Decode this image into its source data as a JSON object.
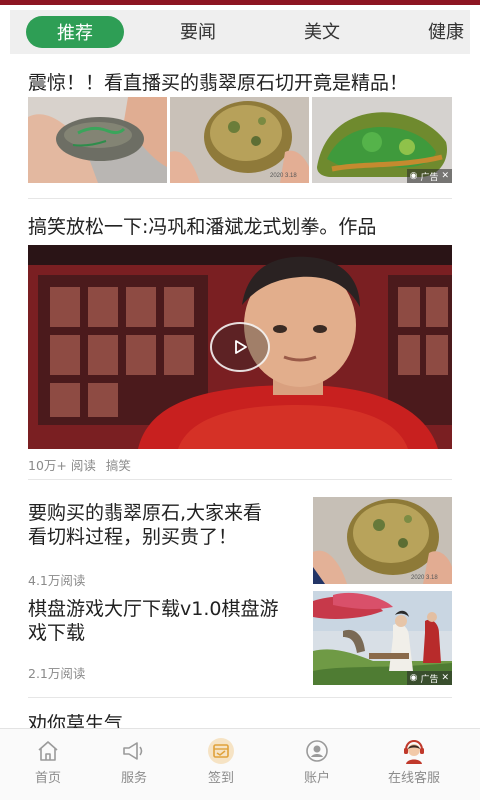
{
  "tabs": [
    {
      "label": "推荐"
    },
    {
      "label": "要闻"
    },
    {
      "label": "美文"
    },
    {
      "label": "健康"
    }
  ],
  "feed": [
    {
      "title": "震惊！！看直播买的翡翠原石切开竟是精品！",
      "ad_label": "广告"
    },
    {
      "title": "搞笑放松一下:冯巩和潘斌龙式划拳。作品",
      "views": "10万+ 阅读",
      "category": "搞笑"
    },
    {
      "title_line1": "要购买的翡翠原石,大家来看",
      "title_line2": "看切料过程，别买贵了！",
      "views": "4.1万阅读"
    },
    {
      "title_line1": "棋盘游戏大厅下载v1.0棋盘游",
      "title_line2": "戏下载",
      "views": "2.1万阅读",
      "ad_label": "广告"
    },
    {
      "title": "劝你莫生气"
    }
  ],
  "bottom_nav": [
    {
      "label": "首页",
      "icon": "home-icon"
    },
    {
      "label": "服务",
      "icon": "megaphone-icon"
    },
    {
      "label": "签到",
      "icon": "calendar-check-icon"
    },
    {
      "label": "账户",
      "icon": "user-icon"
    },
    {
      "label": "在线客服",
      "icon": "customer-service-icon"
    }
  ],
  "colors": {
    "accent": "#2e9e55",
    "top_strip": "#8d1522"
  }
}
